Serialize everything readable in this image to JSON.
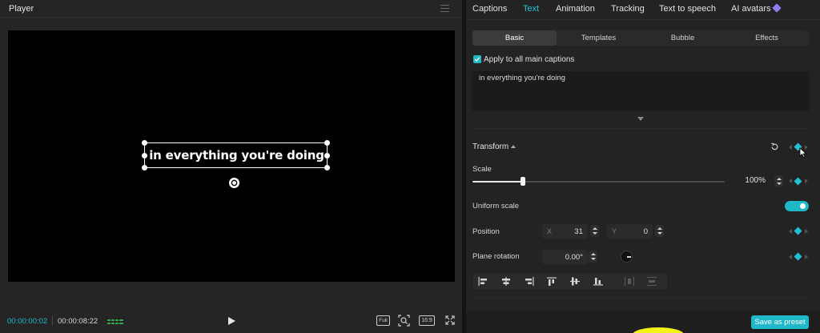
{
  "player": {
    "title": "Player",
    "caption_text": "in everything you're doing",
    "time_current": "00:00:00:02",
    "time_total": "00:00:08:22",
    "full_label": "Full",
    "ratio_label": "16:9"
  },
  "tabs": [
    {
      "label": "Captions",
      "active": false
    },
    {
      "label": "Text",
      "active": true
    },
    {
      "label": "Animation",
      "active": false
    },
    {
      "label": "Tracking",
      "active": false
    },
    {
      "label": "Text to speech",
      "active": false
    },
    {
      "label": "AI avatars",
      "active": false
    }
  ],
  "subtabs": [
    {
      "label": "Basic",
      "active": true
    },
    {
      "label": "Templates",
      "active": false
    },
    {
      "label": "Bubble",
      "active": false
    },
    {
      "label": "Effects",
      "active": false
    }
  ],
  "apply_all": {
    "label": "Apply to all main captions",
    "checked": true
  },
  "text_input": {
    "value": "in everything you're doing"
  },
  "transform": {
    "title": "Transform",
    "scale_label": "Scale",
    "scale_value": "100%",
    "scale_fraction": 0.2,
    "uniform_label": "Uniform scale",
    "uniform_on": true,
    "position_label": "Position",
    "x_axis": "X",
    "x_value": "31",
    "y_axis": "Y",
    "y_value": "0",
    "rotation_label": "Plane rotation",
    "rotation_value": "0.00°"
  },
  "save_preset_label": "Save as preset",
  "colors": {
    "accent": "#1fb8c9",
    "accent_text": "#1fc1d2",
    "ai_icon": "#8f7df0"
  },
  "icons": [
    "menu-icon",
    "rotate-icon",
    "waveform-icon",
    "play-icon",
    "zoom-fit-icon",
    "fullscreen-icon",
    "reset-icon",
    "keyframe-icon",
    "checkmark-icon",
    "ai-gem-icon",
    "align-left-icon",
    "align-center-icon",
    "align-right-icon",
    "align-top-icon",
    "align-middle-icon",
    "align-bottom-icon",
    "distribute-horizontal-icon",
    "distribute-vertical-icon",
    "cursor-icon"
  ]
}
